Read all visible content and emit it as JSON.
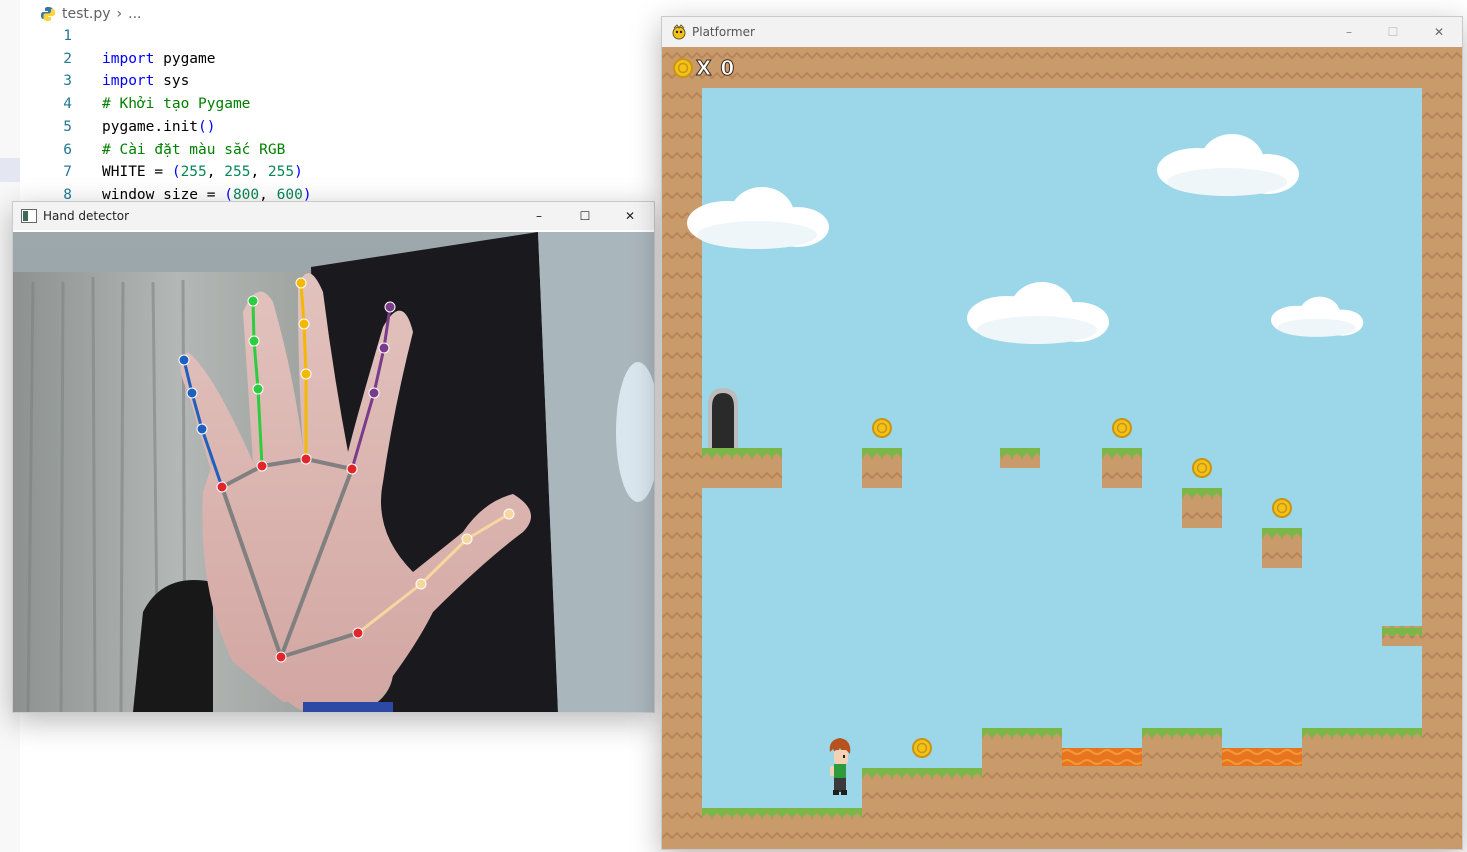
{
  "editor": {
    "file_name": "test.py",
    "breadcrumb_sep": "›",
    "breadcrumb_more": "...",
    "lines": [
      {
        "n": "1",
        "parts": []
      },
      {
        "n": "2",
        "parts": [
          {
            "c": "kw",
            "t": "import"
          },
          {
            "c": "",
            "t": " pygame"
          }
        ]
      },
      {
        "n": "3",
        "parts": [
          {
            "c": "kw",
            "t": "import"
          },
          {
            "c": "",
            "t": " sys"
          }
        ]
      },
      {
        "n": "4",
        "parts": [
          {
            "c": "cm",
            "t": "# Khởi tạo Pygame"
          }
        ]
      },
      {
        "n": "5",
        "parts": [
          {
            "c": "",
            "t": "pygame.init"
          },
          {
            "c": "kw",
            "t": "()"
          }
        ]
      },
      {
        "n": "6",
        "parts": [
          {
            "c": "cm",
            "t": "# Cài đặt màu sắc RGB"
          }
        ]
      },
      {
        "n": "7",
        "parts": [
          {
            "c": "",
            "t": "WHITE = "
          },
          {
            "c": "kw",
            "t": "("
          },
          {
            "c": "nm",
            "t": "255"
          },
          {
            "c": "",
            "t": ", "
          },
          {
            "c": "nm",
            "t": "255"
          },
          {
            "c": "",
            "t": ", "
          },
          {
            "c": "nm",
            "t": "255"
          },
          {
            "c": "kw",
            "t": ")"
          }
        ]
      },
      {
        "n": "8",
        "parts": [
          {
            "c": "",
            "t": "window_size = "
          },
          {
            "c": "kw",
            "t": "("
          },
          {
            "c": "nm",
            "t": "800"
          },
          {
            "c": "",
            "t": ", "
          },
          {
            "c": "nm",
            "t": "600"
          },
          {
            "c": "kw",
            "t": ")"
          }
        ]
      }
    ]
  },
  "hand_window": {
    "title": "Hand detector",
    "minimize": "–",
    "maximize": "☐",
    "close": "✕"
  },
  "game_window": {
    "title": "Platformer",
    "minimize": "–",
    "maximize": "☐",
    "close": "✕",
    "coin_count": "X 0"
  },
  "colors": {
    "sky": "#9bd7e8",
    "dirt": "#c99a6a",
    "grass": "#7ab648",
    "lava": "#e8741e",
    "coin": "#f2c21a",
    "thumb": "#f7d6a0",
    "index": "#2ecc40",
    "middle": "#f5b800",
    "ring": "#7a3b8a",
    "pinky_blue": "#1e5fc0",
    "joint": "#e2252b",
    "palm": "#808080"
  }
}
